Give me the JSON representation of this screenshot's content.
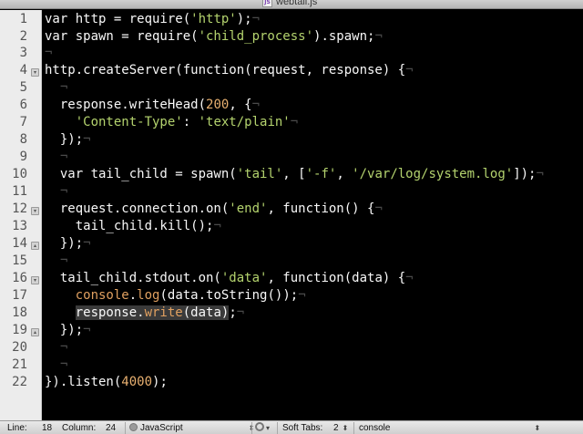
{
  "window": {
    "title": "webtail.js",
    "file_icon_label": "JS"
  },
  "editor": {
    "line_numbers": [
      "1",
      "2",
      "3",
      "4",
      "5",
      "6",
      "7",
      "8",
      "9",
      "10",
      "11",
      "12",
      "13",
      "14",
      "15",
      "16",
      "17",
      "18",
      "19",
      "20",
      "21",
      "22"
    ],
    "lines": {
      "l1a": "var http = require(",
      "l1b": "'http'",
      "l1c": ");",
      "l1i": "¬",
      "l2a": "var spawn = require(",
      "l2b": "'child_process'",
      "l2c": ").spawn;",
      "l2i": "¬",
      "l3i": "¬",
      "l4a": "http.createServer(function(request, response) {",
      "l4i": "¬",
      "l5i": "¬",
      "l6a": "  response.writeHead(",
      "l6b": "200",
      "l6c": ", {",
      "l6i": "¬",
      "l7a": "    ",
      "l7b": "'Content-Type'",
      "l7c": ": ",
      "l7d": "'text/plain'",
      "l7i": "¬",
      "l8a": "  });",
      "l8i": "¬",
      "l9i": "¬",
      "l10a": "  var tail_child = spawn(",
      "l10b": "'tail'",
      "l10c": ", [",
      "l10d": "'-f'",
      "l10e": ", ",
      "l10f": "'/var/log/system.log'",
      "l10g": "]);",
      "l10i": "¬",
      "l11i": "¬",
      "l12a": "  request.connection.on(",
      "l12b": "'end'",
      "l12c": ", function() {",
      "l12i": "¬",
      "l13a": "    tail_child.kill();",
      "l13i": "¬",
      "l14a": "  });",
      "l14i": "¬",
      "l15i": "¬",
      "l16a": "  tail_child.stdout.on(",
      "l16b": "'data'",
      "l16c": ", function(data) {",
      "l16i": "¬",
      "l17a": "    ",
      "l17b": "console",
      "l17c": ".",
      "l17d": "log",
      "l17e": "(data.toString());",
      "l17i": "¬",
      "l18a": "    ",
      "l18b": "response.",
      "l18c": "write",
      "l18d": "(data)",
      "l18e": ";",
      "l18i": "¬",
      "l19a": "  });",
      "l19i": "¬",
      "l20i": "¬",
      "l21i": "¬",
      "l22a": "}).listen(",
      "l22b": "4000",
      "l22c": ");"
    }
  },
  "statusbar": {
    "line_label": "Line:",
    "line_value": "18",
    "column_label": "Column:",
    "column_value": "24",
    "language": "JavaScript",
    "soft_tabs_label": "Soft Tabs:",
    "soft_tabs_value": "2",
    "symbol": "console"
  },
  "colors": {
    "editor_bg": "#000000",
    "string": "#b4d36e",
    "number": "#e8b070",
    "invisible": "#4a4a4a",
    "gutter_bg": "#ececec"
  }
}
